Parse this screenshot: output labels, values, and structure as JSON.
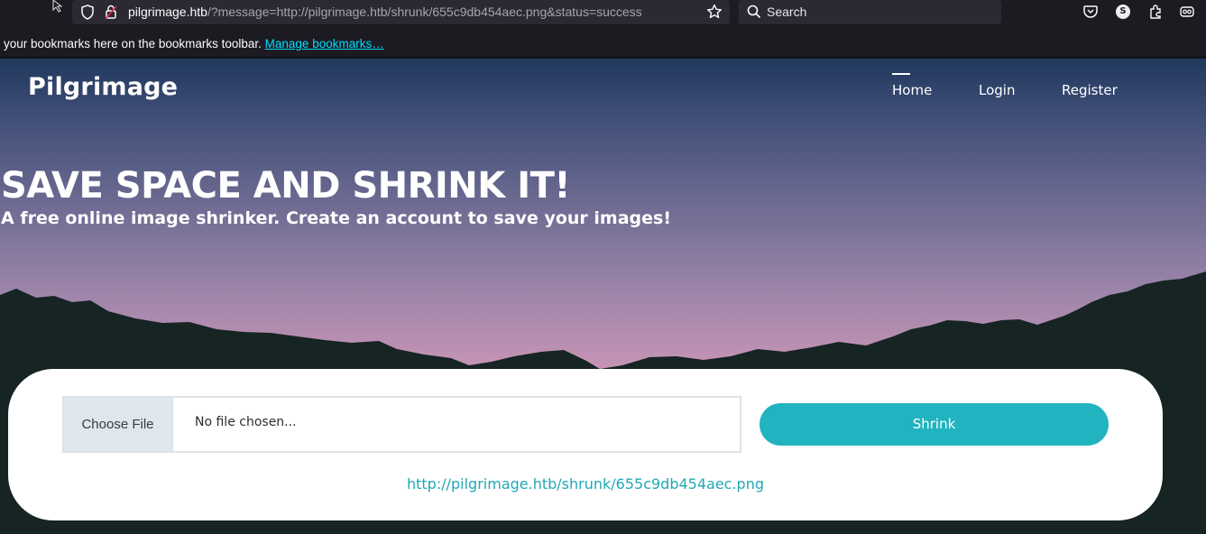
{
  "browser": {
    "url_host": "pilgrimage.htb",
    "url_path": "/?message=http://pilgrimage.htb/shrunk/655c9db454aec.png&status=success",
    "search_placeholder": "Search",
    "profile_initial": "S",
    "bookmarks_text": "your bookmarks here on the bookmarks toolbar. ",
    "bookmarks_link": "Manage bookmarks…"
  },
  "site": {
    "brand": "Pilgrimage",
    "nav": [
      {
        "label": "Home",
        "active": true
      },
      {
        "label": "Login",
        "active": false
      },
      {
        "label": "Register",
        "active": false
      }
    ]
  },
  "hero": {
    "title": "SAVE SPACE AND SHRINK IT!",
    "subtitle": "A free online image shrinker. Create an account to save your images!"
  },
  "upload": {
    "choose_label": "Choose File",
    "status": "No file chosen...",
    "submit_label": "Shrink",
    "result_link": "http://pilgrimage.htb/shrunk/655c9db454aec.png"
  },
  "colors": {
    "accent": "#21b3bf",
    "link": "#21a8b5",
    "mountain": "#162424"
  }
}
